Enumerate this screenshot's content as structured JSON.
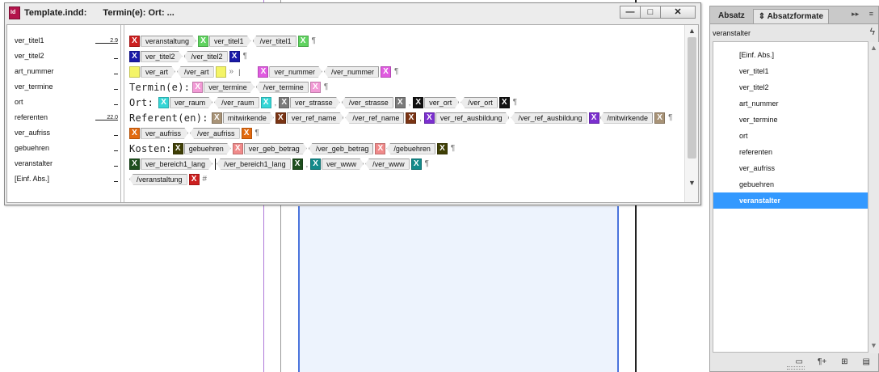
{
  "window": {
    "title": "Template.indd:",
    "subtitle": "Termin(e): Ort: ...",
    "min_label": "—",
    "max_label": "□",
    "close_label": "✕"
  },
  "styles_column": [
    {
      "name": "ver_titel1",
      "depth": "2.9"
    },
    {
      "name": "ver_titel2",
      "depth": ""
    },
    {
      "name": "art_nummer",
      "depth": ""
    },
    {
      "name": "ver_termine",
      "depth": ""
    },
    {
      "name": "ort",
      "depth": ""
    },
    {
      "name": "referenten",
      "depth": "22.0"
    },
    {
      "name": "ver_aufriss",
      "depth": ""
    },
    {
      "name": "gebuehren",
      "depth": ""
    },
    {
      "name": "veranstalter",
      "depth": ""
    },
    {
      "name": "[Einf. Abs.]",
      "depth": ""
    }
  ],
  "story": {
    "line1": {
      "t1": "veranstaltung",
      "t2": "ver_titel1",
      "t3": "/ver_titel1",
      "pil": "¶"
    },
    "line2": {
      "t1": "ver_titel2",
      "t2": "/ver_titel2",
      "pil": "¶"
    },
    "line3": {
      "t1": "ver_art",
      "t2": "/ver_art",
      "raq": "»",
      "bar": "|",
      "t3": "ver_nummer",
      "t4": "/ver_nummer",
      "pil": "¶"
    },
    "line4": {
      "text": "Termin(e):",
      "t1": "ver_termine",
      "t2": "/ver_termine",
      "pil": "¶"
    },
    "line5": {
      "text": "Ort:",
      "t1": "ver_raum",
      "t2": "/ver_raum",
      "comma1": ",",
      "t3": "ver_strasse",
      "t4": "/ver_strasse",
      "comma2": ",",
      "t5": "ver_ort",
      "t6": "/ver_ort",
      "pil": "¶"
    },
    "line6": {
      "text": "Referent(en):",
      "t1": "mitwirkende",
      "t2": "ver_ref_name",
      "t3": "/ver_ref_name",
      "comma": ",",
      "t4": "ver_ref_ausbildung",
      "t5": "/ver_ref_ausbildung",
      "t6": "/mitwirkende",
      "pil": "¶"
    },
    "line7": {
      "t1": "ver_aufriss",
      "t2": "/ver_aufriss",
      "pil": "¶"
    },
    "line8": {
      "text": "Kosten:",
      "t1": "gebuehren",
      "t2": "ver_geb_betrag",
      "t3": "/ver_geb_betrag",
      "t4": "/gebuehren",
      "pil": "¶"
    },
    "line9": {
      "t1": "ver_bereich1_lang",
      "t2": "/ver_bereich1_lang",
      "comma": ",",
      "t3": "ver_www",
      "t4": "/ver_www",
      "pil": "¶"
    },
    "line10": {
      "t1": "/veranstaltung",
      "hash": "#"
    }
  },
  "tag_colors": {
    "red": "#cc1f1f",
    "green": "#5fd35f",
    "navy": "#1a1aa8",
    "yellow": "#f4f466",
    "magenta": "#e05be0",
    "pink": "#f29ad6",
    "cyan": "#35d6d6",
    "gray": "#7b7b7b",
    "black": "#111111",
    "tan": "#a89377",
    "brown": "#7a3414",
    "purple": "#7b2fcf",
    "orange": "#e26a10",
    "olive": "#3f3f05",
    "salmon": "#f08a8a",
    "darkgreen": "#1f4f1f",
    "teal": "#138a8a"
  },
  "panel": {
    "tab1": "Absatz",
    "tab2": "⇕ Absatzformate",
    "menu1": "▸▸",
    "menu2": "≡",
    "current": "veranstalter",
    "bolt": "ϟ",
    "items": [
      "[Einf. Abs.]",
      "ver_titel1",
      "ver_titel2",
      "art_nummer",
      "ver_termine",
      "ort",
      "referenten",
      "ver_aufriss",
      "gebuehren",
      "veranstalter"
    ],
    "selected": "veranstalter",
    "selected_color": "#3399ff",
    "footer": [
      "▭",
      "¶+",
      "⊞",
      "▤"
    ]
  }
}
